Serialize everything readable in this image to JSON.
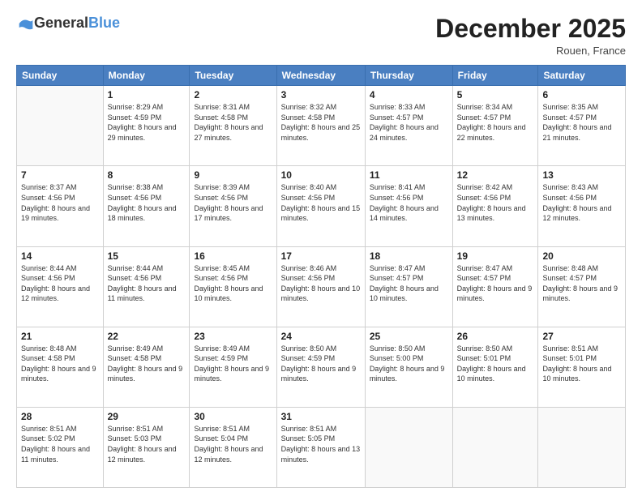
{
  "header": {
    "logo_general": "General",
    "logo_blue": "Blue",
    "month_title": "December 2025",
    "location": "Rouen, France"
  },
  "weekdays": [
    "Sunday",
    "Monday",
    "Tuesday",
    "Wednesday",
    "Thursday",
    "Friday",
    "Saturday"
  ],
  "weeks": [
    [
      {
        "day": "",
        "sunrise": "",
        "sunset": "",
        "daylight": ""
      },
      {
        "day": "1",
        "sunrise": "Sunrise: 8:29 AM",
        "sunset": "Sunset: 4:59 PM",
        "daylight": "Daylight: 8 hours and 29 minutes."
      },
      {
        "day": "2",
        "sunrise": "Sunrise: 8:31 AM",
        "sunset": "Sunset: 4:58 PM",
        "daylight": "Daylight: 8 hours and 27 minutes."
      },
      {
        "day": "3",
        "sunrise": "Sunrise: 8:32 AM",
        "sunset": "Sunset: 4:58 PM",
        "daylight": "Daylight: 8 hours and 25 minutes."
      },
      {
        "day": "4",
        "sunrise": "Sunrise: 8:33 AM",
        "sunset": "Sunset: 4:57 PM",
        "daylight": "Daylight: 8 hours and 24 minutes."
      },
      {
        "day": "5",
        "sunrise": "Sunrise: 8:34 AM",
        "sunset": "Sunset: 4:57 PM",
        "daylight": "Daylight: 8 hours and 22 minutes."
      },
      {
        "day": "6",
        "sunrise": "Sunrise: 8:35 AM",
        "sunset": "Sunset: 4:57 PM",
        "daylight": "Daylight: 8 hours and 21 minutes."
      }
    ],
    [
      {
        "day": "7",
        "sunrise": "Sunrise: 8:37 AM",
        "sunset": "Sunset: 4:56 PM",
        "daylight": "Daylight: 8 hours and 19 minutes."
      },
      {
        "day": "8",
        "sunrise": "Sunrise: 8:38 AM",
        "sunset": "Sunset: 4:56 PM",
        "daylight": "Daylight: 8 hours and 18 minutes."
      },
      {
        "day": "9",
        "sunrise": "Sunrise: 8:39 AM",
        "sunset": "Sunset: 4:56 PM",
        "daylight": "Daylight: 8 hours and 17 minutes."
      },
      {
        "day": "10",
        "sunrise": "Sunrise: 8:40 AM",
        "sunset": "Sunset: 4:56 PM",
        "daylight": "Daylight: 8 hours and 15 minutes."
      },
      {
        "day": "11",
        "sunrise": "Sunrise: 8:41 AM",
        "sunset": "Sunset: 4:56 PM",
        "daylight": "Daylight: 8 hours and 14 minutes."
      },
      {
        "day": "12",
        "sunrise": "Sunrise: 8:42 AM",
        "sunset": "Sunset: 4:56 PM",
        "daylight": "Daylight: 8 hours and 13 minutes."
      },
      {
        "day": "13",
        "sunrise": "Sunrise: 8:43 AM",
        "sunset": "Sunset: 4:56 PM",
        "daylight": "Daylight: 8 hours and 12 minutes."
      }
    ],
    [
      {
        "day": "14",
        "sunrise": "Sunrise: 8:44 AM",
        "sunset": "Sunset: 4:56 PM",
        "daylight": "Daylight: 8 hours and 12 minutes."
      },
      {
        "day": "15",
        "sunrise": "Sunrise: 8:44 AM",
        "sunset": "Sunset: 4:56 PM",
        "daylight": "Daylight: 8 hours and 11 minutes."
      },
      {
        "day": "16",
        "sunrise": "Sunrise: 8:45 AM",
        "sunset": "Sunset: 4:56 PM",
        "daylight": "Daylight: 8 hours and 10 minutes."
      },
      {
        "day": "17",
        "sunrise": "Sunrise: 8:46 AM",
        "sunset": "Sunset: 4:56 PM",
        "daylight": "Daylight: 8 hours and 10 minutes."
      },
      {
        "day": "18",
        "sunrise": "Sunrise: 8:47 AM",
        "sunset": "Sunset: 4:57 PM",
        "daylight": "Daylight: 8 hours and 10 minutes."
      },
      {
        "day": "19",
        "sunrise": "Sunrise: 8:47 AM",
        "sunset": "Sunset: 4:57 PM",
        "daylight": "Daylight: 8 hours and 9 minutes."
      },
      {
        "day": "20",
        "sunrise": "Sunrise: 8:48 AM",
        "sunset": "Sunset: 4:57 PM",
        "daylight": "Daylight: 8 hours and 9 minutes."
      }
    ],
    [
      {
        "day": "21",
        "sunrise": "Sunrise: 8:48 AM",
        "sunset": "Sunset: 4:58 PM",
        "daylight": "Daylight: 8 hours and 9 minutes."
      },
      {
        "day": "22",
        "sunrise": "Sunrise: 8:49 AM",
        "sunset": "Sunset: 4:58 PM",
        "daylight": "Daylight: 8 hours and 9 minutes."
      },
      {
        "day": "23",
        "sunrise": "Sunrise: 8:49 AM",
        "sunset": "Sunset: 4:59 PM",
        "daylight": "Daylight: 8 hours and 9 minutes."
      },
      {
        "day": "24",
        "sunrise": "Sunrise: 8:50 AM",
        "sunset": "Sunset: 4:59 PM",
        "daylight": "Daylight: 8 hours and 9 minutes."
      },
      {
        "day": "25",
        "sunrise": "Sunrise: 8:50 AM",
        "sunset": "Sunset: 5:00 PM",
        "daylight": "Daylight: 8 hours and 9 minutes."
      },
      {
        "day": "26",
        "sunrise": "Sunrise: 8:50 AM",
        "sunset": "Sunset: 5:01 PM",
        "daylight": "Daylight: 8 hours and 10 minutes."
      },
      {
        "day": "27",
        "sunrise": "Sunrise: 8:51 AM",
        "sunset": "Sunset: 5:01 PM",
        "daylight": "Daylight: 8 hours and 10 minutes."
      }
    ],
    [
      {
        "day": "28",
        "sunrise": "Sunrise: 8:51 AM",
        "sunset": "Sunset: 5:02 PM",
        "daylight": "Daylight: 8 hours and 11 minutes."
      },
      {
        "day": "29",
        "sunrise": "Sunrise: 8:51 AM",
        "sunset": "Sunset: 5:03 PM",
        "daylight": "Daylight: 8 hours and 12 minutes."
      },
      {
        "day": "30",
        "sunrise": "Sunrise: 8:51 AM",
        "sunset": "Sunset: 5:04 PM",
        "daylight": "Daylight: 8 hours and 12 minutes."
      },
      {
        "day": "31",
        "sunrise": "Sunrise: 8:51 AM",
        "sunset": "Sunset: 5:05 PM",
        "daylight": "Daylight: 8 hours and 13 minutes."
      },
      {
        "day": "",
        "sunrise": "",
        "sunset": "",
        "daylight": ""
      },
      {
        "day": "",
        "sunrise": "",
        "sunset": "",
        "daylight": ""
      },
      {
        "day": "",
        "sunrise": "",
        "sunset": "",
        "daylight": ""
      }
    ]
  ]
}
